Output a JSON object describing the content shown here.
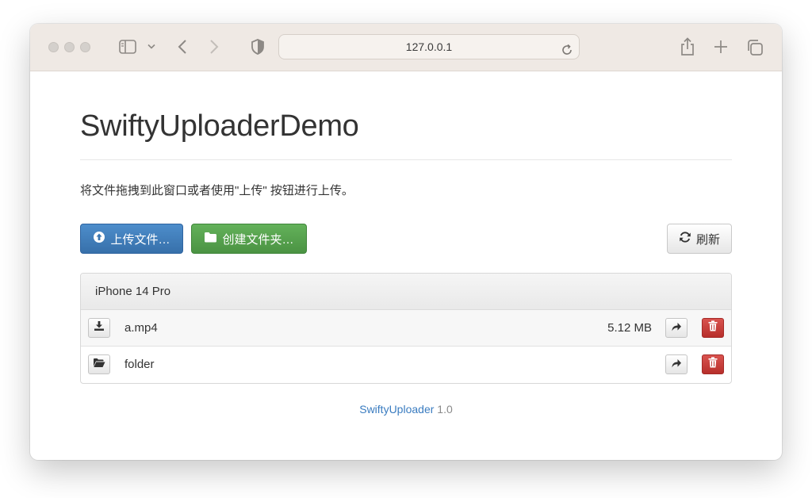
{
  "browser": {
    "address": "127.0.0.1"
  },
  "page": {
    "title": "SwiftyUploaderDemo",
    "instructions": "将文件拖拽到此窗口或者使用\"上传\" 按钮进行上传。"
  },
  "actions": {
    "upload_label": "上传文件…",
    "mkdir_label": "创建文件夹…",
    "refresh_label": "刷新"
  },
  "panel": {
    "heading": "iPhone 14 Pro",
    "items": [
      {
        "name": "a.mp4",
        "size": "5.12 MB",
        "type": "file",
        "icon": "download-icon"
      },
      {
        "name": "folder",
        "size": "",
        "type": "folder",
        "icon": "folder-open-icon"
      }
    ]
  },
  "footer": {
    "link": "SwiftyUploader",
    "version": "1.0"
  },
  "colors": {
    "primary": "#3770aa",
    "success": "#4b9343",
    "danger": "#c9302c",
    "link": "#3a7cc0"
  }
}
